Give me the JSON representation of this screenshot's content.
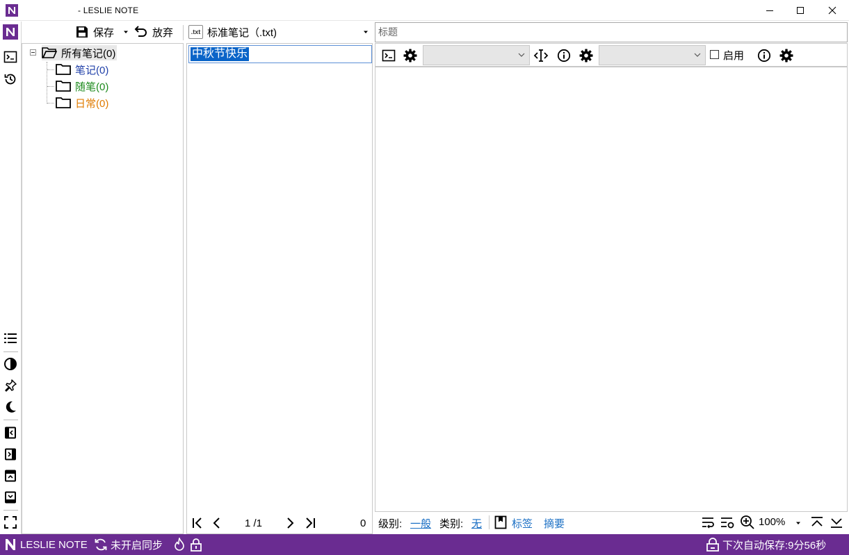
{
  "window": {
    "title": "- LESLIE NOTE",
    "app_logo_icon": "leslie-note-logo",
    "accent_color": "#6a2c91"
  },
  "toolbar": {
    "save_label": "保存",
    "discard_label": "放弃",
    "note_type_badge": ".txt",
    "note_type_label": "标准笔记（.txt)"
  },
  "tree": {
    "root": {
      "label": "所有笔记(0)"
    },
    "children": [
      {
        "label": "笔记(0)",
        "color": "#1f3fa8"
      },
      {
        "label": "随笔(0)",
        "color": "#1d8a1d"
      },
      {
        "label": "日常(0)",
        "color": "#e07b00"
      }
    ]
  },
  "note_list": {
    "items": [
      {
        "title": "中秋节快乐",
        "selected": true
      }
    ],
    "pager": {
      "page": "1 /1",
      "count": "0"
    }
  },
  "editor": {
    "title_placeholder": "标题",
    "toolbar": {
      "combo1_value": "",
      "combo2_value": "",
      "enable_label": "启用",
      "enable_checked": false
    },
    "body": "",
    "bottom": {
      "level_label": "级别:",
      "level_value": "一般",
      "category_label": "类别:",
      "category_value": "无",
      "tags_label": "标签",
      "summary_label": "摘要",
      "zoom": "100%"
    }
  },
  "status": {
    "app_name": "LESLIE NOTE",
    "sync_label": "未开启同步",
    "autosave_text": "下次自动保存:9分56秒"
  }
}
